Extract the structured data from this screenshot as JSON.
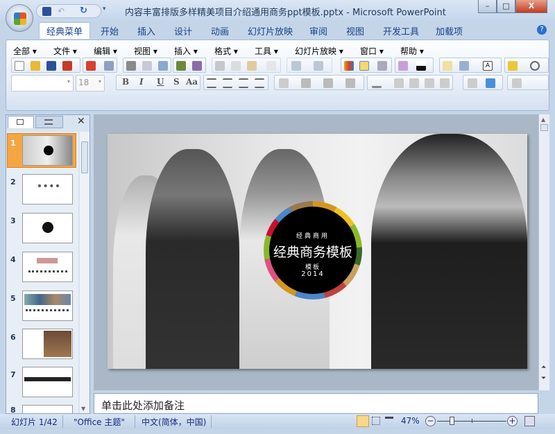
{
  "window": {
    "title": "内容丰富排版多样精美项目介绍通用商务ppt模板.pptx - Microsoft PowerPoint",
    "minimize": "–",
    "maximize": "□",
    "close": "X"
  },
  "tabs": [
    "经典菜单",
    "开始",
    "插入",
    "设计",
    "动画",
    "幻灯片放映",
    "审阅",
    "视图",
    "开发工具",
    "加载项"
  ],
  "active_tab": "经典菜单",
  "menu": [
    "全部 ▾",
    "文件 ▾",
    "编辑 ▾",
    "视图 ▾",
    "插入 ▾",
    "格式 ▾",
    "工具 ▾",
    "幻灯片放映 ▾",
    "窗口 ▾",
    "帮助 ▾"
  ],
  "format": {
    "font_name": "",
    "font_size": "18",
    "bold": "B",
    "italic": "I",
    "underline": "U",
    "shadow": "S",
    "case": "Aa"
  },
  "slides_panel": {
    "slide_numbers": [
      "1",
      "2",
      "3",
      "4",
      "5",
      "6",
      "7",
      "8"
    ],
    "selected": 1
  },
  "slide": {
    "subtitle_top": "经典商用",
    "title": "经典商务模板",
    "subtitle_bottom": "模板",
    "year": "2014",
    "ring_colors": [
      "#c8102e",
      "#4a86c8",
      "#9a7a4c",
      "#d4961c",
      "#f0c020",
      "#8ab828",
      "#3a6a2a",
      "#c8a060",
      "#c04040",
      "#e05080"
    ]
  },
  "notes": {
    "placeholder": "单击此处添加备注"
  },
  "status": {
    "slide": "幻灯片 1/42",
    "theme": "\"Office 主题\"",
    "language": "中文(简体，中国)",
    "zoom": "47%",
    "zoom_level_percent": 47
  },
  "colors": {
    "accent": "#15428b",
    "selected_thumb": "#f5a643"
  }
}
